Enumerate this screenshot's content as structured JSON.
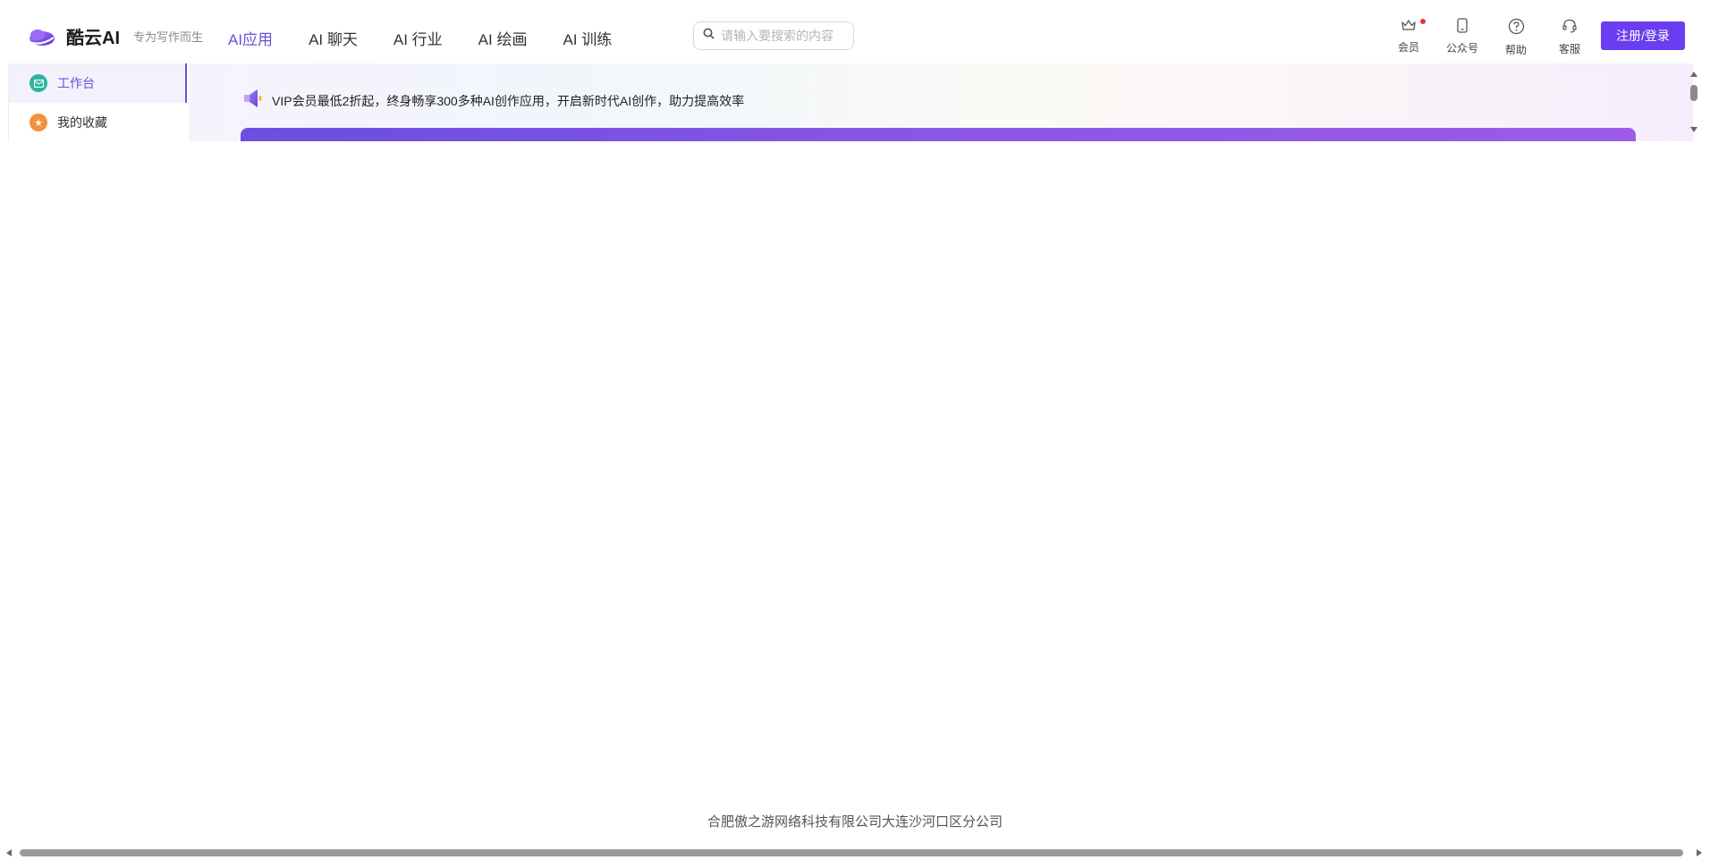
{
  "header": {
    "brand": "酷云AI",
    "slogan": "专为写作而生",
    "nav": [
      {
        "label": "AI应用",
        "active": true
      },
      {
        "label": "AI 聊天"
      },
      {
        "label": "AI 行业"
      },
      {
        "label": "AI 绘画"
      },
      {
        "label": "AI 训练"
      }
    ],
    "search_placeholder": "请输入要搜索的内容",
    "tools": [
      {
        "label": "会员",
        "icon": "crown-icon",
        "badge": true
      },
      {
        "label": "公众号",
        "icon": "phone-icon"
      },
      {
        "label": "帮助",
        "icon": "help-icon"
      },
      {
        "label": "客服",
        "icon": "headset-icon"
      }
    ],
    "login_label": "注册/登录"
  },
  "sidebar": {
    "items": [
      {
        "label": "工作台",
        "icon": "workbench-icon",
        "active": true
      },
      {
        "label": "我的收藏",
        "icon": "star-icon"
      }
    ]
  },
  "content": {
    "notice": "VIP会员最低2折起，终身畅享300多种AI创作应用，开启新时代AI创作，助力提高效率"
  },
  "footer": {
    "company": "合肥傲之游网络科技有限公司大连沙河口区分公司"
  },
  "colors": {
    "accent": "#6a3df0",
    "active_text": "#6b4fd8",
    "badge_red": "#e53935"
  }
}
